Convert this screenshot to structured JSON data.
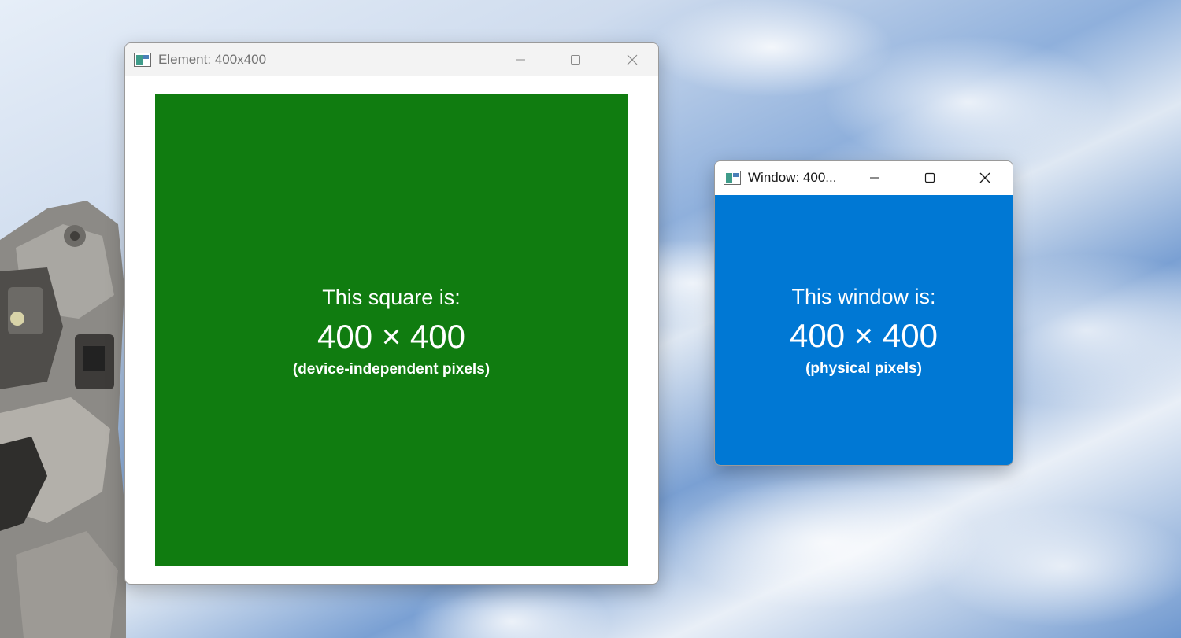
{
  "desktop": {
    "wallpaper": "earth-clouds-from-orbit"
  },
  "element_window": {
    "title": "Element: 400x400",
    "icon": "app-window-icon",
    "title_color": "#737373",
    "square": {
      "color": "#107c10",
      "line1": "This square is:",
      "line2": "400 × 400",
      "line3": "(device-independent pixels)"
    }
  },
  "window_window": {
    "title": "Window: 400...",
    "icon": "app-window-icon",
    "title_color": "#1a1a1a",
    "panel": {
      "color": "#0078d4",
      "line1": "This window is:",
      "line2": "400 × 400",
      "line3": "(physical pixels)"
    }
  },
  "caption_buttons": {
    "minimize": "minimize-icon",
    "maximize": "maximize-icon",
    "close": "close-icon"
  }
}
